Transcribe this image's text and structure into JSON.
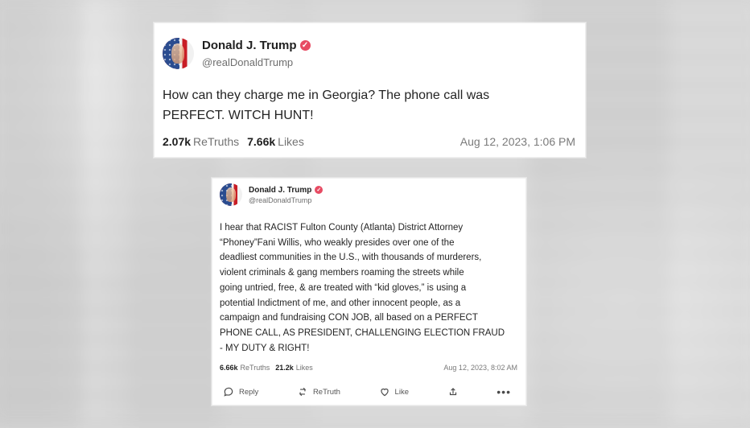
{
  "posts": [
    {
      "author": {
        "name": "Donald J. Trump",
        "handle": "@realDonaldTrump"
      },
      "text": "How can they charge me in Georgia? The phone call was\nPERFECT. WITCH HUNT!",
      "stats": {
        "retruths_value": "2.07k",
        "retruths_label": "ReTruths",
        "likes_value": "7.66k",
        "likes_label": "Likes"
      },
      "timestamp": "Aug 12, 2023, 1:06 PM"
    },
    {
      "author": {
        "name": "Donald J. Trump",
        "handle": "@realDonaldTrump"
      },
      "text": "I hear that RACIST Fulton County (Atlanta) District Attorney\n“Phoney”Fani Willis, who weakly presides over one of the\ndeadliest communities in the U.S., with thousands of murderers,\nviolent criminals & gang members roaming the streets while\ngoing untried, free, & are treated with “kid gloves,” is using a\npotential Indictment of me, and other innocent people, as a\ncampaign and fundraising CON JOB, all based on a PERFECT\nPHONE CALL, AS PRESIDENT, CHALLENGING ELECTION FRAUD\n- MY DUTY & RIGHT!",
      "stats": {
        "retruths_value": "6.66k",
        "retruths_label": "ReTruths",
        "likes_value": "21.2k",
        "likes_label": "Likes"
      },
      "timestamp": "Aug 12, 2023, 8:02 AM",
      "actions": {
        "reply": "Reply",
        "retruth": "ReTruth",
        "like": "Like"
      }
    }
  ],
  "ui": {
    "verified_icon": "check-badge-icon",
    "reply_icon": "speech-bubble-icon",
    "retruth_icon": "repost-icon",
    "like_icon": "heart-icon",
    "share_icon": "share-icon",
    "more_icon": "more-horizontal-icon",
    "verified_color": "#e74b63",
    "text_color": "#161616",
    "muted_color": "#777777"
  }
}
